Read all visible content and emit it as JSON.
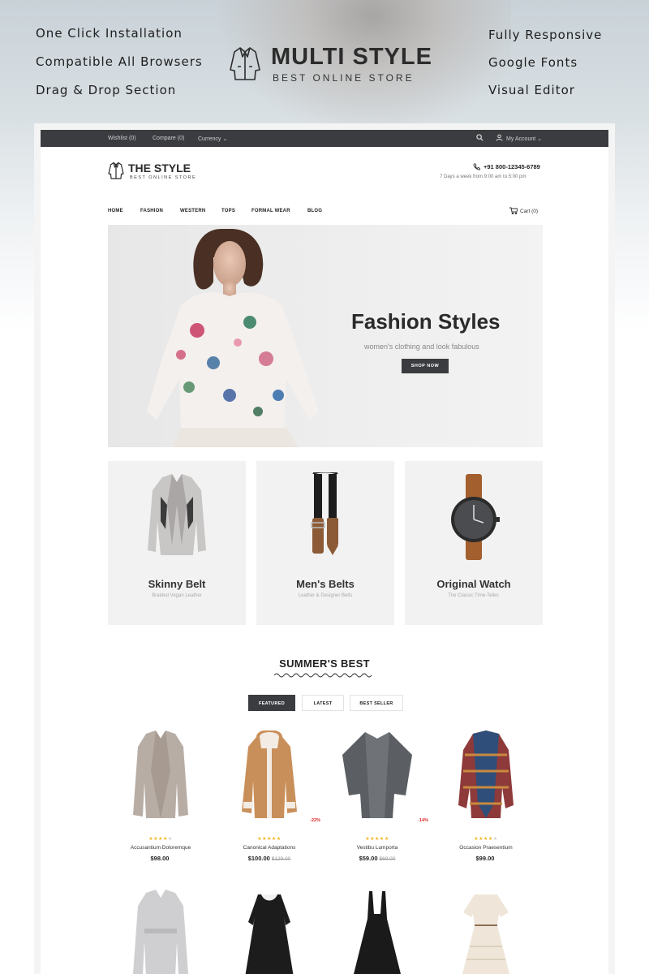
{
  "promo": {
    "features_left": [
      "One Click Installation",
      "Compatible All Browsers",
      "Drag & Drop Section"
    ],
    "features_right": [
      "Fully Responsive",
      "Google Fonts",
      "Visual Editor"
    ],
    "brand_name": "MULTI STYLE",
    "brand_tagline": "BEST ONLINE STORE",
    "brand_icon": "coat-icon"
  },
  "site": {
    "topbar": {
      "wishlist": "Wishlist (0)",
      "compare": "Compare (0)",
      "currency": "Currency ⌄",
      "account": "My Account ⌄",
      "search_icon": "search-icon",
      "user_icon": "user-icon"
    },
    "logo": {
      "name": "THE STYLE",
      "tagline": "BEST ONLINE STORE"
    },
    "contact": {
      "phone": "+91 800-12345-6789",
      "hours": "7 Days a week from 9:00 am to 5:00 pm"
    },
    "nav": [
      "HOME",
      "FASHION",
      "WESTERN",
      "TOPS",
      "FORMAL WEAR",
      "BLOG"
    ],
    "cart": "Cart (0)",
    "hero": {
      "title": "Fashion Styles",
      "subtitle": "women's clothing and look fabulous",
      "button": "SHOP NOW"
    },
    "categories": [
      {
        "title": "Skinny Belt",
        "subtitle": "Braided Vegan Leather",
        "icon": "cardigan-icon"
      },
      {
        "title": "Men's Belts",
        "subtitle": "Leather & Designer Belts",
        "icon": "belt-icon"
      },
      {
        "title": "Original Watch",
        "subtitle": "The Classic Time-Teller.",
        "icon": "watch-icon"
      }
    ],
    "section": {
      "title": "SUMMER'S BEST",
      "tabs": [
        "FEATURED",
        "LATEST",
        "BEST SELLER"
      ],
      "active_tab": "FEATURED"
    },
    "products": [
      {
        "name": "Accusantium Doloremque",
        "price": "$98.00",
        "old_price": "",
        "badge": "",
        "rating": 4
      },
      {
        "name": "Canonical Adaptations",
        "price": "$100.00",
        "old_price": "$129.00",
        "badge": "-22%",
        "rating": 5
      },
      {
        "name": "Vestibu Lumporta",
        "price": "$59.00",
        "old_price": "$69.00",
        "badge": "-14%",
        "rating": 5
      },
      {
        "name": "Occasion Praesentium",
        "price": "$99.00",
        "old_price": "",
        "badge": "",
        "rating": 4
      }
    ],
    "colors": {
      "dark": "#3a3c40",
      "star": "#f3b51c",
      "sale": "#e0262b"
    }
  }
}
